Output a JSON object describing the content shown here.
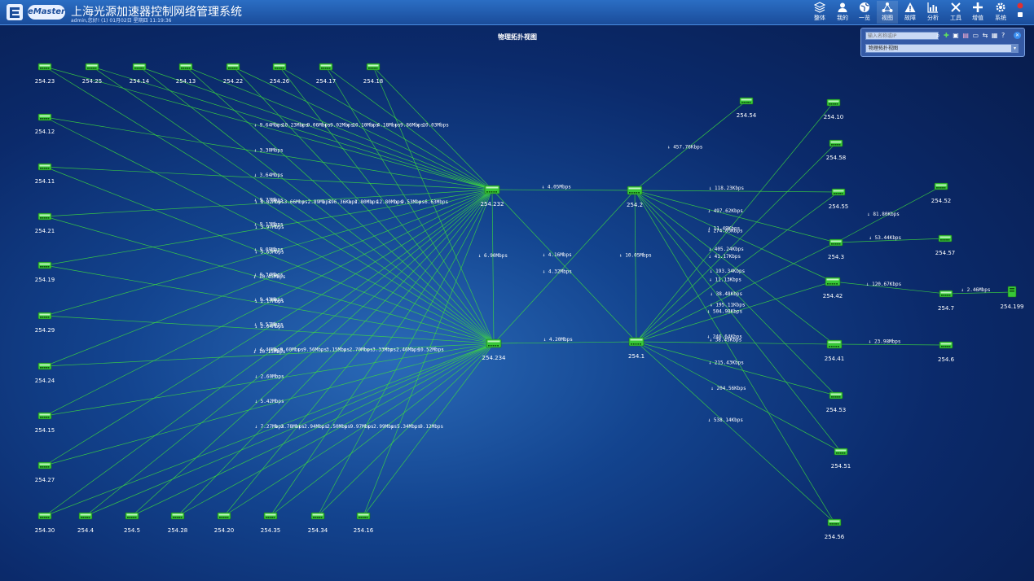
{
  "app": {
    "title": "上海光源加速器控制网络管理系统",
    "subtitle": "admin,您好! (1) 01月02日 星期四 11:19:36",
    "brand": "eMaster",
    "nav": [
      {
        "label": "整体",
        "icon": "layers-icon"
      },
      {
        "label": "我的",
        "icon": "user-icon"
      },
      {
        "label": "一览",
        "icon": "globe-icon"
      },
      {
        "label": "视图",
        "icon": "topology-icon",
        "active": true
      },
      {
        "label": "故障",
        "icon": "warning-icon"
      },
      {
        "label": "分析",
        "icon": "chart-icon"
      },
      {
        "label": "工具",
        "icon": "tools-icon"
      },
      {
        "label": "增值",
        "icon": "plus-icon"
      },
      {
        "label": "系统",
        "icon": "gear-icon"
      }
    ]
  },
  "map": {
    "title": "物理拓扑视图",
    "search_placeholder": "输入名称或IP",
    "view_select": "物理拓扑视图",
    "tool_icons": [
      "search-icon",
      "add-icon",
      "save-icon",
      "layout-icon",
      "monitor-icon",
      "share-icon",
      "grid-icon",
      "help-icon"
    ]
  },
  "colors": {
    "link": "#3ddc3d",
    "device": "#37c837",
    "label": "#ffffff"
  },
  "nodes": [
    {
      "id": "254.23",
      "label": "254.23",
      "type": "switch"
    },
    {
      "id": "254.25",
      "label": "254.25",
      "type": "switch"
    },
    {
      "id": "254.14",
      "label": "254.14",
      "type": "switch"
    },
    {
      "id": "254.13",
      "label": "254.13",
      "type": "switch"
    },
    {
      "id": "254.22",
      "label": "254.22",
      "type": "switch"
    },
    {
      "id": "254.26",
      "label": "254.26",
      "type": "switch"
    },
    {
      "id": "254.17",
      "label": "254.17",
      "type": "switch"
    },
    {
      "id": "254.18",
      "label": "254.18",
      "type": "switch"
    },
    {
      "id": "254.12",
      "label": "254.12",
      "type": "switch"
    },
    {
      "id": "254.11",
      "label": "254.11",
      "type": "switch"
    },
    {
      "id": "254.21",
      "label": "254.21",
      "type": "switch"
    },
    {
      "id": "254.19",
      "label": "254.19",
      "type": "switch"
    },
    {
      "id": "254.29",
      "label": "254.29",
      "type": "switch"
    },
    {
      "id": "254.24",
      "label": "254.24",
      "type": "switch"
    },
    {
      "id": "254.15",
      "label": "254.15",
      "type": "switch"
    },
    {
      "id": "254.27",
      "label": "254.27",
      "type": "switch"
    },
    {
      "id": "254.30",
      "label": "254.30",
      "type": "switch"
    },
    {
      "id": "254.4",
      "label": "254.4",
      "type": "switch"
    },
    {
      "id": "254.5",
      "label": "254.5",
      "type": "switch"
    },
    {
      "id": "254.28",
      "label": "254.28",
      "type": "switch"
    },
    {
      "id": "254.20",
      "label": "254.20",
      "type": "switch"
    },
    {
      "id": "254.35",
      "label": "254.35",
      "type": "switch"
    },
    {
      "id": "254.34",
      "label": "254.34",
      "type": "switch"
    },
    {
      "id": "254.16",
      "label": "254.16",
      "type": "switch"
    },
    {
      "id": "254.232",
      "label": "254.232",
      "type": "core"
    },
    {
      "id": "254.234",
      "label": "254.234",
      "type": "core"
    },
    {
      "id": "254.2",
      "label": "254.2",
      "type": "core"
    },
    {
      "id": "254.1",
      "label": "254.1",
      "type": "core"
    },
    {
      "id": "254.54",
      "label": "254.54",
      "type": "switch"
    },
    {
      "id": "254.10",
      "label": "254.10",
      "type": "switch"
    },
    {
      "id": "254.58",
      "label": "254.58",
      "type": "switch"
    },
    {
      "id": "254.55",
      "label": "254.55",
      "type": "switch"
    },
    {
      "id": "254.52",
      "label": "254.52",
      "type": "switch"
    },
    {
      "id": "254.3",
      "label": "254.3",
      "type": "switch"
    },
    {
      "id": "254.57",
      "label": "254.57",
      "type": "switch"
    },
    {
      "id": "254.42",
      "label": "254.42",
      "type": "core"
    },
    {
      "id": "254.7",
      "label": "254.7",
      "type": "switch"
    },
    {
      "id": "254.199",
      "label": "254.199",
      "type": "server"
    },
    {
      "id": "254.41",
      "label": "254.41",
      "type": "core"
    },
    {
      "id": "254.6",
      "label": "254.6",
      "type": "switch"
    },
    {
      "id": "254.53",
      "label": "254.53",
      "type": "switch"
    },
    {
      "id": "254.51",
      "label": "254.51",
      "type": "switch"
    },
    {
      "id": "254.56",
      "label": "254.56",
      "type": "switch"
    }
  ],
  "links": [
    {
      "from": "254.23",
      "to": "254.232",
      "rate": "↓ 9.64Mbps"
    },
    {
      "from": "254.25",
      "to": "254.232",
      "rate": "↓ 10.23Mbps"
    },
    {
      "from": "254.14",
      "to": "254.232",
      "rate": "↓ 9.06Mbps"
    },
    {
      "from": "254.13",
      "to": "254.232",
      "rate": "↓ 9.02Mbps"
    },
    {
      "from": "254.22",
      "to": "254.232",
      "rate": "↓ 10.10Mbps"
    },
    {
      "from": "254.26",
      "to": "254.232",
      "rate": "↓ 4.18Mbps"
    },
    {
      "from": "254.17",
      "to": "254.232",
      "rate": "↓ 9.86Mbps"
    },
    {
      "from": "254.18",
      "to": "254.232",
      "rate": "↓ 10.03Mbps"
    },
    {
      "from": "254.12",
      "to": "254.232",
      "rate": "↓ 3.30Mbps"
    },
    {
      "from": "254.11",
      "to": "254.232",
      "rate": "↓ 3.64Mbps"
    },
    {
      "from": "254.21",
      "to": "254.232",
      "rate": "↓ 9.77Mbps"
    },
    {
      "from": "254.19",
      "to": "254.232",
      "rate": "↓ 9.13Mbps"
    },
    {
      "from": "254.29",
      "to": "254.232",
      "rate": "↓ 9.09Mbps"
    },
    {
      "from": "254.24",
      "to": "254.232",
      "rate": "↓ 9.34Mbps"
    },
    {
      "from": "254.15",
      "to": "254.232",
      "rate": "↓ 9.43Mbps"
    },
    {
      "from": "254.27",
      "to": "254.232",
      "rate": "↓ 9.57Mbps"
    },
    {
      "from": "254.30",
      "to": "254.232",
      "rate": "↓ 4.46Mbps"
    },
    {
      "from": "254.4",
      "to": "254.232",
      "rate": "↓ 9.60Mbps"
    },
    {
      "from": "254.5",
      "to": "254.232",
      "rate": "↓ 9.56Mbps"
    },
    {
      "from": "254.28",
      "to": "254.232",
      "rate": "↓ 3.15Mbps"
    },
    {
      "from": "254.20",
      "to": "254.232",
      "rate": "↓ 2.70Mbps"
    },
    {
      "from": "254.35",
      "to": "254.232",
      "rate": "↓ 3.33Mbps"
    },
    {
      "from": "254.34",
      "to": "254.232",
      "rate": "↓ 2.46Mbps"
    },
    {
      "from": "254.16",
      "to": "254.232",
      "rate": "↓ 10.52Mbps"
    },
    {
      "from": "254.23",
      "to": "254.234",
      "rate": "↓ 8.82Mbps"
    },
    {
      "from": "254.25",
      "to": "254.234",
      "rate": "↓ 3.66Mbps"
    },
    {
      "from": "254.14",
      "to": "254.234",
      "rate": "↓ 2.89Mbps"
    },
    {
      "from": "254.13",
      "to": "254.234",
      "rate": "↓ 796.36Kbps"
    },
    {
      "from": "254.22",
      "to": "254.234",
      "rate": "↓ 2.80Mbps"
    },
    {
      "from": "254.26",
      "to": "254.234",
      "rate": "↓ 12.80Mbps"
    },
    {
      "from": "254.17",
      "to": "254.234",
      "rate": "↓ 9.53Mbps"
    },
    {
      "from": "254.18",
      "to": "254.234",
      "rate": "↓ 6.63Mbps"
    },
    {
      "from": "254.12",
      "to": "254.234",
      "rate": "↓ 3.97Mbps"
    },
    {
      "from": "254.11",
      "to": "254.234",
      "rate": "↓ 3.63Mbps"
    },
    {
      "from": "254.21",
      "to": "254.234",
      "rate": "↓ 10.43Mbps"
    },
    {
      "from": "254.19",
      "to": "254.234",
      "rate": "↓ 2.17Mbps"
    },
    {
      "from": "254.29",
      "to": "254.234",
      "rate": "↓ 2.04Mbps"
    },
    {
      "from": "254.24",
      "to": "254.234",
      "rate": "↓ 10.13Mbps"
    },
    {
      "from": "254.15",
      "to": "254.234",
      "rate": "↓ 2.60Mbps"
    },
    {
      "from": "254.27",
      "to": "254.234",
      "rate": "↓ 5.42Mbps"
    },
    {
      "from": "254.30",
      "to": "254.234",
      "rate": "↓ 7.27Mbps"
    },
    {
      "from": "254.4",
      "to": "254.234",
      "rate": "↓ 2.78Mbps"
    },
    {
      "from": "254.5",
      "to": "254.234",
      "rate": "↓ 2.94Mbps"
    },
    {
      "from": "254.28",
      "to": "254.234",
      "rate": "↓ 2.50Mbps"
    },
    {
      "from": "254.20",
      "to": "254.234",
      "rate": "↓ 9.97Mbps"
    },
    {
      "from": "254.35",
      "to": "254.234",
      "rate": "↓ 2.99Mbps"
    },
    {
      "from": "254.34",
      "to": "254.234",
      "rate": "↓ 5.34Mbps"
    },
    {
      "from": "254.16",
      "to": "254.234",
      "rate": "↓ 9.12Mbps"
    },
    {
      "from": "254.232",
      "to": "254.2",
      "rate": "↓ 4.05Mbps"
    },
    {
      "from": "254.234",
      "to": "254.1",
      "rate": "↓ 4.20Mbps"
    },
    {
      "from": "254.232",
      "to": "254.234",
      "rate": "↓ 6.90Mbps"
    },
    {
      "from": "254.232",
      "to": "254.1",
      "rate": "↓ 4.16Mbps"
    },
    {
      "from": "254.234",
      "to": "254.2",
      "rate": "↓ 4.32Mbps"
    },
    {
      "from": "254.2",
      "to": "254.1",
      "rate": "↓ 10.05Mbps"
    },
    {
      "from": "254.2",
      "to": "254.54",
      "rate": "↓ 457.76Kbps"
    },
    {
      "from": "254.2",
      "to": "254.55",
      "rate": "↓ 118.23Kbps"
    },
    {
      "from": "254.2",
      "to": "254.3",
      "rate": "↓ 497.62Kbps"
    },
    {
      "from": "254.2",
      "to": "254.42",
      "rate": "↓ 11.49Kbps"
    },
    {
      "from": "254.1",
      "to": "254.58",
      "rate": "↓ 405.24Kbps"
    },
    {
      "from": "254.2",
      "to": "254.41",
      "rate": "↓ 41.17Kbps"
    },
    {
      "from": "254.1",
      "to": "254.10",
      "rate": "↓ 274.05Kbps"
    },
    {
      "from": "254.2",
      "to": "254.53",
      "rate": "↓ 11.13Kbps"
    },
    {
      "from": "254.1",
      "to": "254.55",
      "rate": "↓ 193.34Kbps"
    },
    {
      "from": "254.2",
      "to": "254.51",
      "rate": "↓ 195.11Kbps"
    },
    {
      "from": "254.1",
      "to": "254.3",
      "rate": "↓ 38.48Kbps"
    },
    {
      "from": "254.1",
      "to": "254.42",
      "rate": "↓ 504.98Kbps"
    },
    {
      "from": "254.1",
      "to": "254.41",
      "rate": "↓ 38.45Kbps"
    },
    {
      "from": "254.1",
      "to": "254.53",
      "rate": "↓ 215.43Kbps"
    },
    {
      "from": "254.1",
      "to": "254.51",
      "rate": "↓ 204.56Kbps"
    },
    {
      "from": "254.1",
      "to": "254.56",
      "rate": "↓ 538.14Kbps"
    },
    {
      "from": "254.2",
      "to": "254.56",
      "rate": "↓ 246.64Kbps"
    },
    {
      "from": "254.3",
      "to": "254.52",
      "rate": "↓ 81.80Kbps"
    },
    {
      "from": "254.3",
      "to": "254.57",
      "rate": "↓ 53.44Kbps"
    },
    {
      "from": "254.42",
      "to": "254.7",
      "rate": "↓ 120.67Kbps"
    },
    {
      "from": "254.7",
      "to": "254.199",
      "rate": "↓ 2.46Mbps"
    },
    {
      "from": "254.41",
      "to": "254.6",
      "rate": "↓ 23.98Mbps"
    }
  ]
}
